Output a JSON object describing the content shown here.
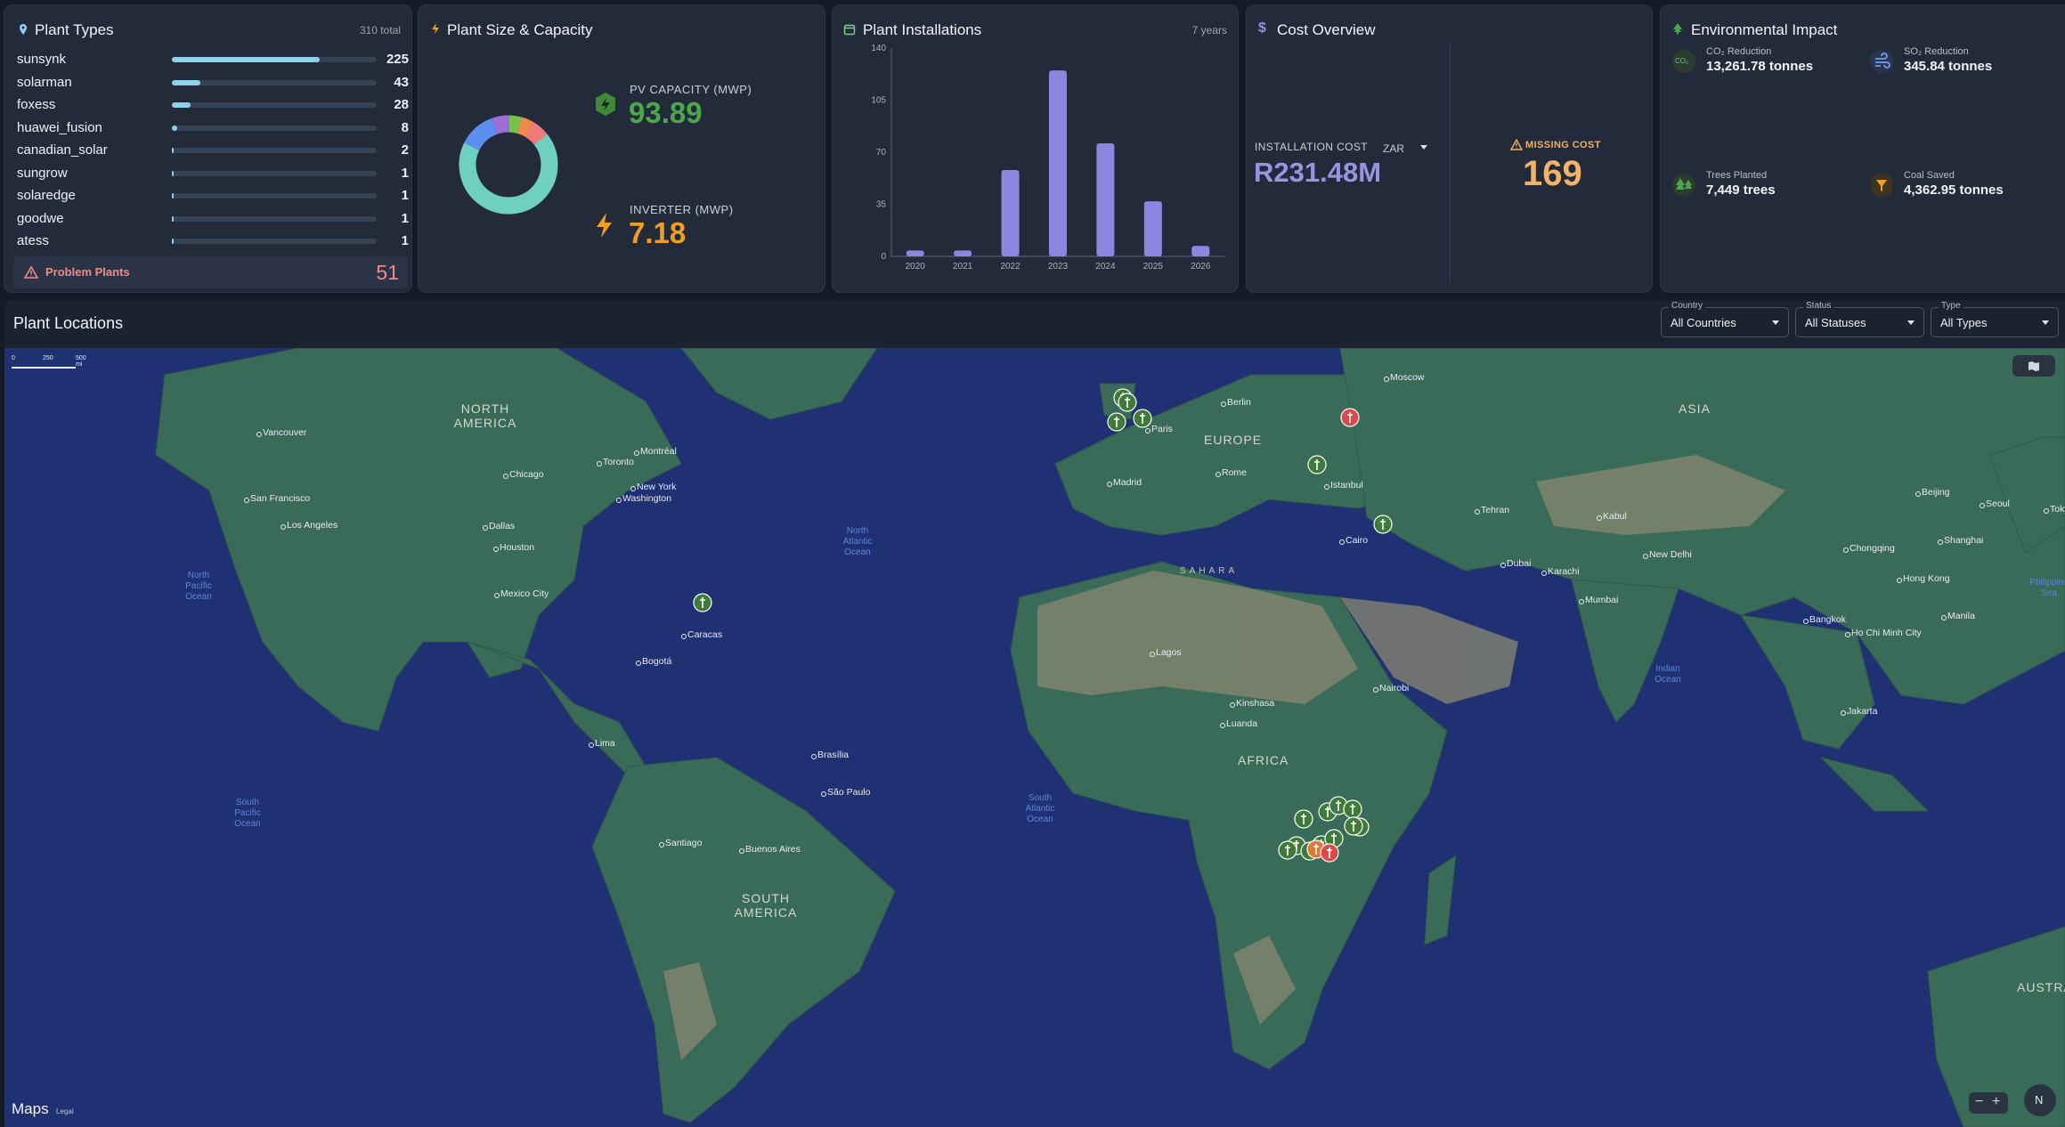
{
  "plant_types": {
    "title": "Plant Types",
    "total": "310 total",
    "max": 225,
    "rows": [
      {
        "name": "sunsynk",
        "count": 225
      },
      {
        "name": "solarman",
        "count": 43
      },
      {
        "name": "foxess",
        "count": 28
      },
      {
        "name": "huawei_fusion",
        "count": 8
      },
      {
        "name": "canadian_solar",
        "count": 2
      },
      {
        "name": "sungrow",
        "count": 1
      },
      {
        "name": "solaredge",
        "count": 1
      },
      {
        "name": "goodwe",
        "count": 1
      },
      {
        "name": "atess",
        "count": 1
      }
    ],
    "problem_label": "Problem Plants",
    "problem_count": "51"
  },
  "capacity": {
    "title": "Plant Size & Capacity",
    "pv_label": "PV CAPACITY (MWP)",
    "pv_value": "93.89",
    "inverter_label": "INVERTER (MWP)",
    "inverter_value": "7.18",
    "donut": [
      {
        "share": 0.68,
        "color": "#6fcfc0"
      },
      {
        "share": 0.12,
        "color": "#5b8ff0"
      },
      {
        "share": 0.06,
        "color": "#9a6fd6"
      },
      {
        "share": 0.04,
        "color": "#77c24a"
      },
      {
        "share": 0.04,
        "color": "#f08a4a"
      },
      {
        "share": 0.06,
        "color": "#f07a7a"
      }
    ]
  },
  "installations": {
    "title": "Plant Installations",
    "meta": "7 years",
    "chart_data": {
      "type": "bar",
      "categories": [
        "2020",
        "2021",
        "2022",
        "2023",
        "2024",
        "2025",
        "2026"
      ],
      "values": [
        4,
        4,
        58,
        125,
        76,
        37,
        7
      ],
      "ylim": [
        0,
        140
      ],
      "yticks": [
        "0",
        "35",
        "70",
        "105",
        "140"
      ],
      "color": "#8b86e0"
    }
  },
  "cost": {
    "title": "Cost Overview",
    "install_label": "INSTALLATION COST",
    "currency": "ZAR",
    "install_value": "R231.48M",
    "missing_label": "MISSING COST",
    "missing_value": "169"
  },
  "environment": {
    "title": "Environmental Impact",
    "items": [
      {
        "label": "CO₂ Reduction",
        "value": "13,261.78 tonnes",
        "icon": "co2-icon"
      },
      {
        "label": "SO₂ Reduction",
        "value": "345.84 tonnes",
        "icon": "wind-icon"
      },
      {
        "label": "Trees Planted",
        "value": "7,449 trees",
        "icon": "tree-icon"
      },
      {
        "label": "Coal Saved",
        "value": "4,362.95 tonnes",
        "icon": "filter-icon"
      }
    ]
  },
  "locations": {
    "title": "Plant Locations",
    "filters": [
      {
        "label": "Country",
        "value": "All Countries"
      },
      {
        "label": "Status",
        "value": "All Statuses"
      },
      {
        "label": "Type",
        "value": "All Types"
      }
    ]
  },
  "map": {
    "scale": [
      "0",
      "250",
      "500 mi"
    ],
    "attribution": "Maps",
    "legal": "Legal",
    "compass": "N",
    "regions": [
      "NORTH AMERICA",
      "EUROPE",
      "ASIA",
      "AFRICA",
      "SOUTH AMERICA",
      "AUSTRALIA",
      "SAHARA"
    ],
    "oceans": [
      "North Pacific Ocean",
      "North Atlantic Ocean",
      "South Atlantic Ocean",
      "South Pacific Ocean",
      "Indian Ocean",
      "Philippine Sea"
    ],
    "cities": [
      "Vancouver",
      "San Francisco",
      "Los Angeles",
      "Chicago",
      "Toronto",
      "Montréal",
      "New York",
      "Washington",
      "Dallas",
      "Houston",
      "Mexico City",
      "Caracas",
      "Bogotá",
      "Lima",
      "Brasília",
      "São Paulo",
      "Santiago",
      "Buenos Aires",
      "Moscow",
      "Berlin",
      "Paris",
      "Madrid",
      "Rome",
      "Istanbul",
      "Cairo",
      "Tehran",
      "Kabul",
      "New Delhi",
      "Karachi",
      "Dubai",
      "Mumbai",
      "Beijing",
      "Seoul",
      "Tokyo",
      "Shanghai",
      "Chongqing",
      "Hong Kong",
      "Bangkok",
      "Ho Chi Minh City",
      "Manila",
      "Jakarta",
      "Lagos",
      "Kinshasa",
      "Luanda",
      "Nairobi"
    ]
  }
}
